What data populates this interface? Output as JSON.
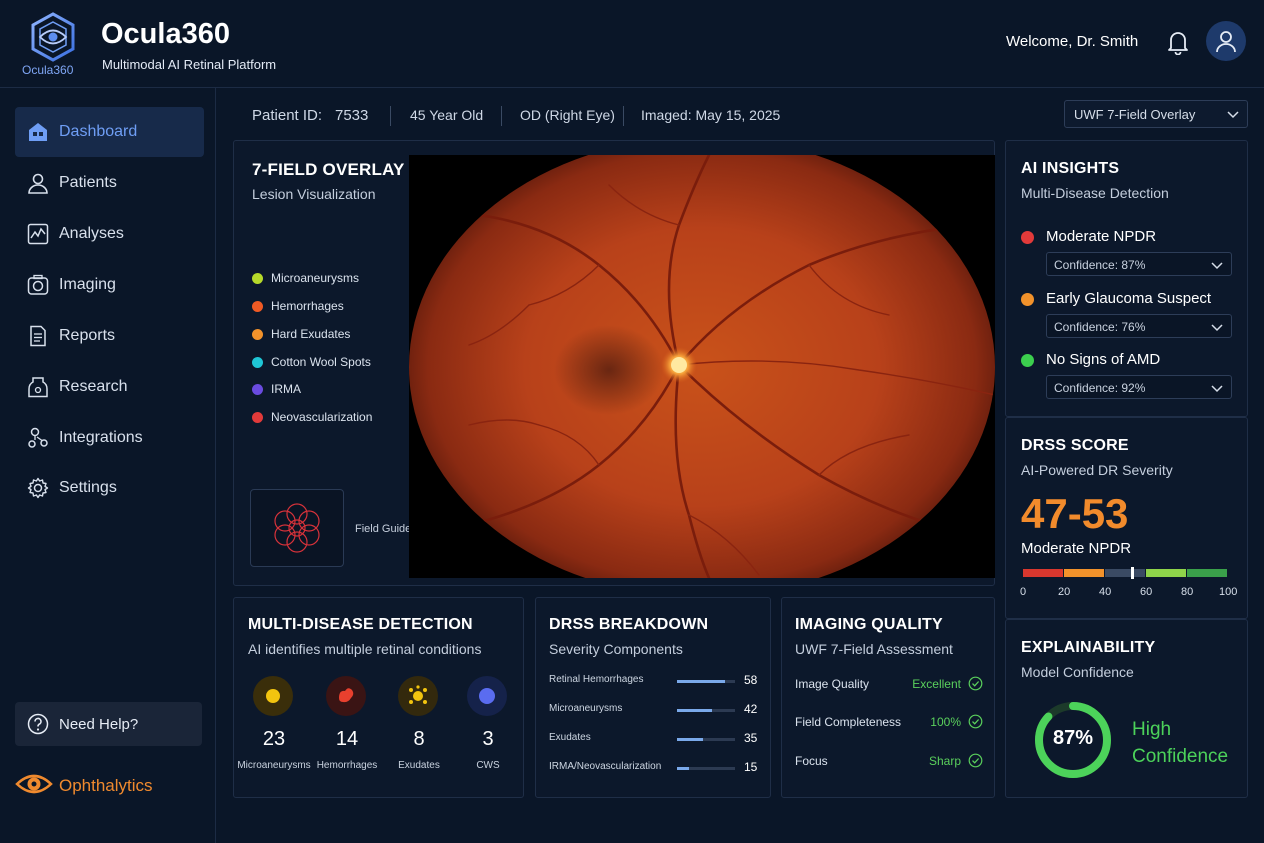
{
  "app": {
    "logo_caption": "Ocula360",
    "title": "Ocula360",
    "subtitle": "Multimodal AI Retinal Platform",
    "welcome": "Welcome, Dr. Smith",
    "icons": {
      "bell": "bell-icon",
      "avatar": "user-avatar-icon"
    }
  },
  "sidebar": {
    "items": [
      {
        "label": "Dashboard",
        "icon": "dashboard-icon",
        "active": true
      },
      {
        "label": "Patients",
        "icon": "patients-icon"
      },
      {
        "label": "Analyses",
        "icon": "analyses-icon"
      },
      {
        "label": "Imaging",
        "icon": "camera-icon"
      },
      {
        "label": "Reports",
        "icon": "reports-icon"
      },
      {
        "label": "Research",
        "icon": "research-icon"
      },
      {
        "label": "Integrations",
        "icon": "integrations-icon"
      },
      {
        "label": "Settings",
        "icon": "gear-icon"
      }
    ],
    "help_label": "Need Help?",
    "brand_label": "Ophthalytics"
  },
  "patient": {
    "id_label": "Patient ID:",
    "id_value": "7533",
    "age": "45 Year Old",
    "eye": "OD (Right Eye)",
    "imaged": "Imaged: May 15, 2025",
    "view_select": "UWF 7-Field Overlay"
  },
  "overlay": {
    "title": "7-FIELD OVERLAY",
    "subtitle": "Lesion Visualization",
    "legend": [
      {
        "label": "Microaneurysms",
        "color": "#b6d92a"
      },
      {
        "label": "Hemorrhages",
        "color": "#f05a24"
      },
      {
        "label": "Hard Exudates",
        "color": "#f2922b"
      },
      {
        "label": "Cotton Wool Spots",
        "color": "#1fc6d6"
      },
      {
        "label": "IRMA",
        "color": "#6a4be0"
      },
      {
        "label": "Neovascularization",
        "color": "#e23a3a"
      }
    ],
    "field_guide_label": "Field Guide"
  },
  "ai_insights": {
    "title": "AI INSIGHTS",
    "subtitle": "Multi-Disease Detection",
    "items": [
      {
        "label": "Moderate NPDR",
        "confidence": "Confidence: 87%",
        "color": "#e23a3a"
      },
      {
        "label": "Early Glaucoma Suspect",
        "confidence": "Confidence: 76%",
        "color": "#f2922b"
      },
      {
        "label": "No Signs of AMD",
        "confidence": "Confidence: 92%",
        "color": "#3ccf4e"
      }
    ]
  },
  "drss": {
    "title": "DRSS SCORE",
    "subtitle": "AI-Powered DR Severity",
    "score": "47-53",
    "severity": "Moderate NPDR",
    "marker_value": 53,
    "scale_ticks": [
      "0",
      "20",
      "40",
      "60",
      "80",
      "100"
    ],
    "scale_colors": [
      "#d9372e",
      "#f2922b",
      "#3a4a63",
      "#8fd44a",
      "#3aa04a"
    ]
  },
  "explainability": {
    "title": "EXPLAINABILITY",
    "subtitle": "Model Confidence",
    "value": "87%",
    "fraction": 0.87,
    "label": "High Confidence",
    "color": "#4cd25a"
  },
  "multi_disease": {
    "title": "MULTI-DISEASE DETECTION",
    "subtitle": "AI identifies multiple retinal conditions",
    "stats": [
      {
        "count": "23",
        "label": "Microaneurysms",
        "color": "#f2c40f",
        "bg": "#3a2e0a"
      },
      {
        "count": "14",
        "label": "Hemorrhages",
        "color": "#e8402e",
        "bg": "#3a1414"
      },
      {
        "count": "8",
        "label": "Exudates",
        "color": "#f2c40f",
        "bg": "#33290d"
      },
      {
        "count": "3",
        "label": "CWS",
        "color": "#5a6cf0",
        "bg": "#15224a"
      }
    ]
  },
  "drss_breakdown": {
    "title": "DRSS BREAKDOWN",
    "subtitle": "Severity Components",
    "rows": [
      {
        "label": "Retinal Hemorrhages",
        "value": "58",
        "fraction": 0.82
      },
      {
        "label": "Microaneurysms",
        "value": "42",
        "fraction": 0.6
      },
      {
        "label": "Exudates",
        "value": "35",
        "fraction": 0.45
      },
      {
        "label": "IRMA/Neovascularization",
        "value": "15",
        "fraction": 0.2
      }
    ]
  },
  "imaging_quality": {
    "title": "IMAGING QUALITY",
    "subtitle": "UWF 7-Field Assessment",
    "rows": [
      {
        "label": "Image Quality",
        "value": "Excellent"
      },
      {
        "label": "Field Completeness",
        "value": "100%"
      },
      {
        "label": "Focus",
        "value": "Sharp"
      }
    ]
  }
}
